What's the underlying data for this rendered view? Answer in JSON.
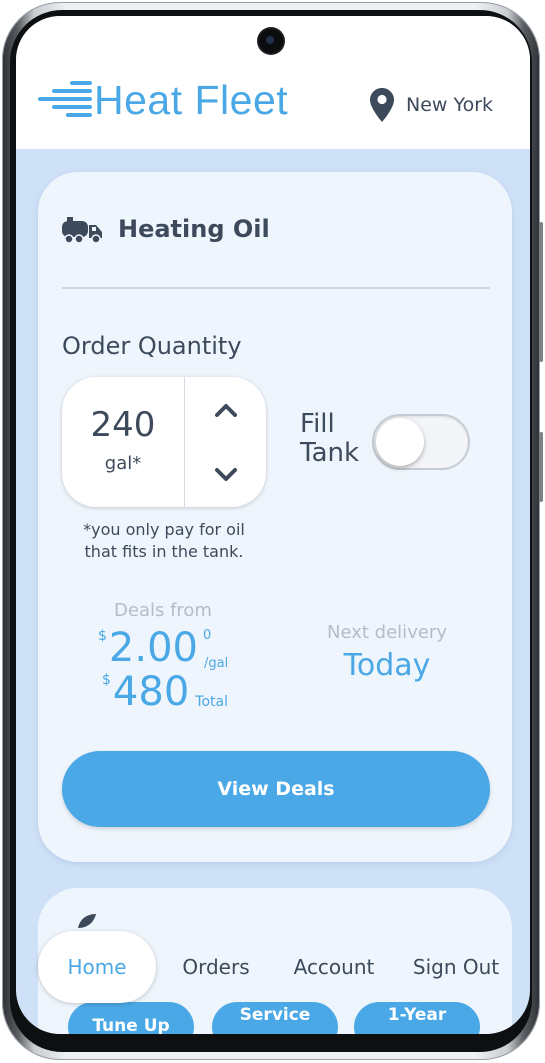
{
  "header": {
    "brand": "Heat Fleet",
    "location": "New York"
  },
  "card": {
    "title": "Heating Oil",
    "order_quantity_label": "Order Quantity",
    "quantity_value": "240",
    "quantity_unit": "gal*",
    "fill_tank_label_line1": "Fill",
    "fill_tank_label_line2": "Tank",
    "fill_tank_on": false,
    "note_line1": "*you only pay for oil",
    "note_line2": "that fits in the tank.",
    "deals_from_label": "Deals from",
    "price_currency": "$",
    "price_per_gal": "2.00",
    "price_superscript": "0",
    "price_unit": "/gal",
    "total_currency": "$",
    "total_value": "480",
    "total_word": "Total",
    "next_delivery_label": "Next delivery",
    "next_delivery_value": "Today",
    "view_deals_label": "View Deals"
  },
  "nav": {
    "items": [
      {
        "label": "Home",
        "active": true
      },
      {
        "label": "Orders"
      },
      {
        "label": "Account"
      },
      {
        "label": "Sign Out"
      }
    ]
  },
  "service_pills": [
    "Tune Up",
    "Service",
    "1-Year"
  ],
  "colors": {
    "accent": "#4aa8e6",
    "text": "#3d4a5c",
    "muted": "#b4bcc6",
    "background": "#cfe1f7",
    "card": "#eff5fc"
  },
  "icons": {
    "logo": "speed-lines-icon",
    "location": "map-pin-icon",
    "product": "oil-truck-icon",
    "increment": "chevron-up-icon",
    "decrement": "chevron-down-icon"
  }
}
